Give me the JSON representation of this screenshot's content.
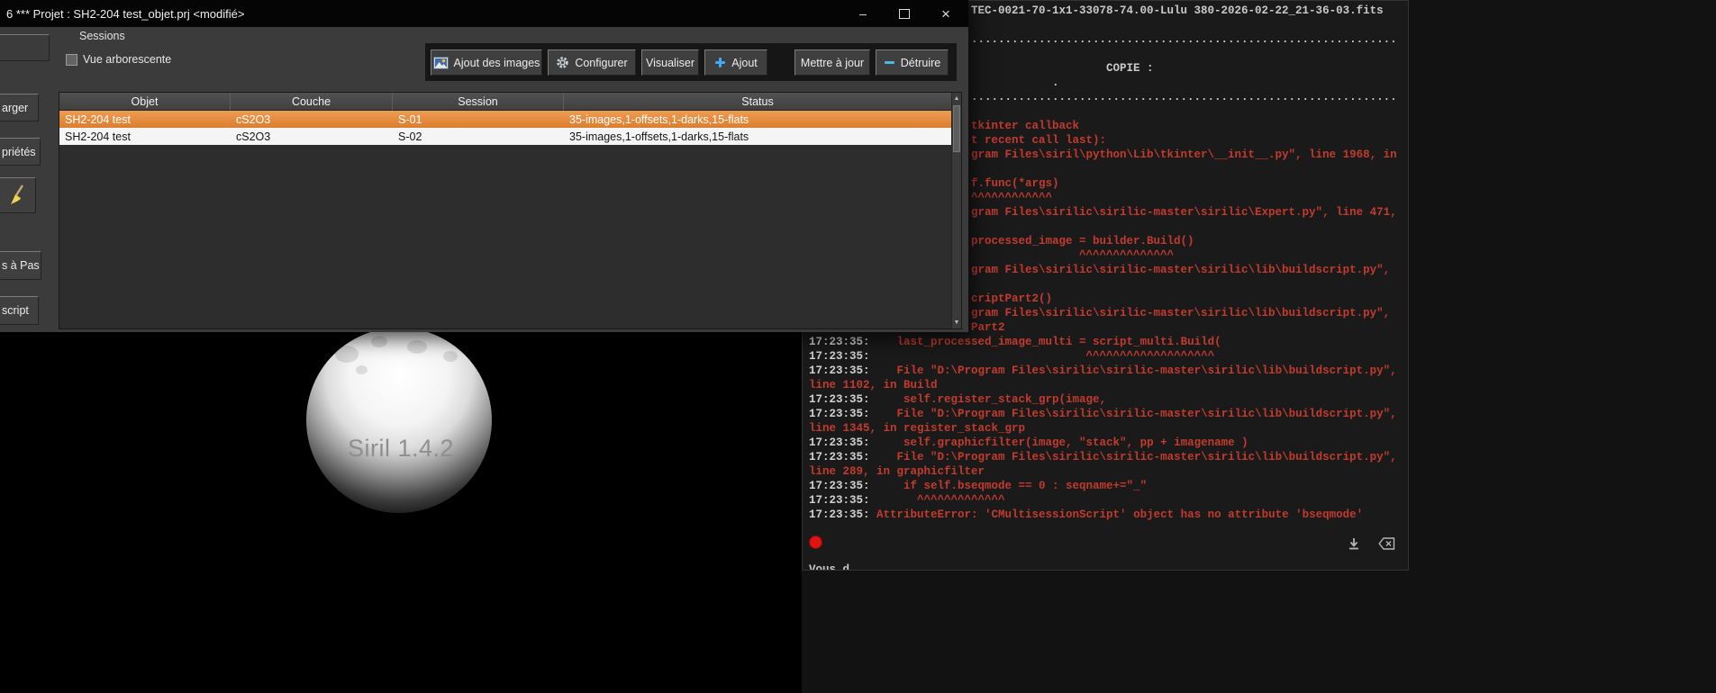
{
  "colors": {
    "selected-row": "#db7e2e",
    "selected-row-light": "#ef9c54",
    "error-red": "#c23b2e",
    "record-red": "#e01212",
    "console-text": "#c9c9c9",
    "window-bg": "#3b3b3b",
    "titlebar-bg": "#050505"
  },
  "window": {
    "title": "6 *** Projet : SH2-204 test_objet.prj <modifié>",
    "controls": {
      "minimize": "–",
      "close": "×"
    }
  },
  "sessions": {
    "label": "Sessions",
    "checkbox_label": "Vue arborescente",
    "toolbar": [
      {
        "label": "Ajout des images",
        "icon": "image"
      },
      {
        "label": "Configurer",
        "icon": "gear"
      },
      {
        "label": "Visualiser",
        "icon": null
      },
      {
        "label": "Ajout",
        "icon": "plus"
      },
      {
        "label": "Mettre à jour",
        "icon": null
      },
      {
        "label": "Détruire",
        "icon": "minus"
      }
    ],
    "table": {
      "columns": [
        "Objet",
        "Couche",
        "Session",
        "Status"
      ],
      "rows": [
        {
          "cells": [
            "SH2-204 test",
            "cS2O3",
            "S-01",
            "35-images,1-offsets,1-darks,15-flats"
          ],
          "selected": true
        },
        {
          "cells": [
            "SH2-204 test",
            "cS2O3",
            "S-02",
            "35-images,1-offsets,1-darks,15-flats"
          ],
          "selected": false
        }
      ]
    }
  },
  "left_toolbar": [
    {
      "label": "",
      "icon": null
    },
    {
      "label": "arger",
      "icon": null
    },
    {
      "label": "priétés",
      "icon": null
    },
    {
      "label": "",
      "icon": "broom"
    },
    {
      "label": "s à Pas",
      "icon": null
    },
    {
      "label": "script",
      "icon": null
    }
  ],
  "splash": {
    "version": "Siril 1.4.2"
  },
  "console": {
    "bottom_partial": "Vous d",
    "lines": [
      {
        "zone": "top",
        "color": "w",
        "text": "TEC-0021-70-1x1-33078-74.00-Lulu 380-2026-02-22_21-36-03.fits"
      },
      {
        "zone": "top",
        "color": "w",
        "text": ""
      },
      {
        "zone": "top",
        "color": "w",
        "text": "..............................................................."
      },
      {
        "zone": "top",
        "color": "w",
        "text": ""
      },
      {
        "zone": "top",
        "color": "w",
        "text": "                    COPIE :"
      },
      {
        "zone": "top",
        "color": "w",
        "text": "            ."
      },
      {
        "zone": "top",
        "color": "w",
        "text": "..............................................................."
      },
      {
        "zone": "top",
        "color": "w",
        "text": ""
      },
      {
        "zone": "top",
        "color": "r",
        "text": "tkinter callback"
      },
      {
        "zone": "top",
        "color": "r",
        "text": "t recent call last):"
      },
      {
        "zone": "top",
        "color": "r",
        "text": "gram Files\\siril\\python\\Lib\\tkinter\\__init__.py\", line 1968, in"
      },
      {
        "zone": "top",
        "color": "r",
        "text": ""
      },
      {
        "zone": "top",
        "color": "r",
        "text": "f.func(*args)"
      },
      {
        "zone": "top",
        "color": "r",
        "text": "^^^^^^^^^^^^"
      },
      {
        "zone": "top",
        "color": "r",
        "text": "gram Files\\sirilic\\sirilic-master\\sirilic\\Expert.py\", line 471,"
      },
      {
        "zone": "top",
        "color": "r",
        "text": ""
      },
      {
        "zone": "top",
        "color": "r",
        "text": "processed_image = builder.Build()"
      },
      {
        "zone": "top",
        "color": "r",
        "text": "                ^^^^^^^^^^^^^^"
      },
      {
        "zone": "top",
        "color": "r",
        "text": "gram Files\\sirilic\\sirilic-master\\sirilic\\lib\\buildscript.py\","
      },
      {
        "zone": "top",
        "color": "r",
        "text": ""
      },
      {
        "zone": "top",
        "color": "r",
        "text": "criptPart2()"
      },
      {
        "zone": "top",
        "color": "r",
        "text": "gram Files\\sirilic\\sirilic-master\\sirilic\\lib\\buildscript.py\","
      },
      {
        "zone": "top",
        "color": "r",
        "text": "Part2"
      },
      {
        "zone": "main",
        "ts": "17:23:35:",
        "color": "r",
        "text": "    last_processed_image_multi = script_multi.Build("
      },
      {
        "zone": "main",
        "ts": "17:23:35:",
        "color": "r",
        "text": "                                ^^^^^^^^^^^^^^^^^^^"
      },
      {
        "zone": "main",
        "ts": "17:23:35:",
        "color": "r",
        "text": "    File \"D:\\Program Files\\sirilic\\sirilic-master\\sirilic\\lib\\buildscript.py\","
      },
      {
        "zone": "main",
        "color": "r",
        "text": "line 1102, in Build"
      },
      {
        "zone": "main",
        "ts": "17:23:35:",
        "color": "r",
        "text": "     self.register_stack_grp(image,"
      },
      {
        "zone": "main",
        "ts": "17:23:35:",
        "color": "r",
        "text": "    File \"D:\\Program Files\\sirilic\\sirilic-master\\sirilic\\lib\\buildscript.py\","
      },
      {
        "zone": "main",
        "color": "r",
        "text": "line 1345, in register_stack_grp"
      },
      {
        "zone": "main",
        "ts": "17:23:35:",
        "color": "r",
        "text": "     self.graphicfilter(image, \"stack\", pp + imagename )"
      },
      {
        "zone": "main",
        "ts": "17:23:35:",
        "color": "r",
        "text": "    File \"D:\\Program Files\\sirilic\\sirilic-master\\sirilic\\lib\\buildscript.py\","
      },
      {
        "zone": "main",
        "color": "r",
        "text": "line 289, in graphicfilter"
      },
      {
        "zone": "main",
        "ts": "17:23:35:",
        "color": "r",
        "text": "     if self.bseqmode == 0 : seqname+=\"_\""
      },
      {
        "zone": "main",
        "ts": "17:23:35:",
        "color": "r",
        "text": "       ^^^^^^^^^^^^^"
      },
      {
        "zone": "main",
        "ts": "17:23:35:",
        "color": "r",
        "text": " AttributeError: 'CMultisessionScript' object has no attribute 'bseqmode'"
      }
    ]
  }
}
